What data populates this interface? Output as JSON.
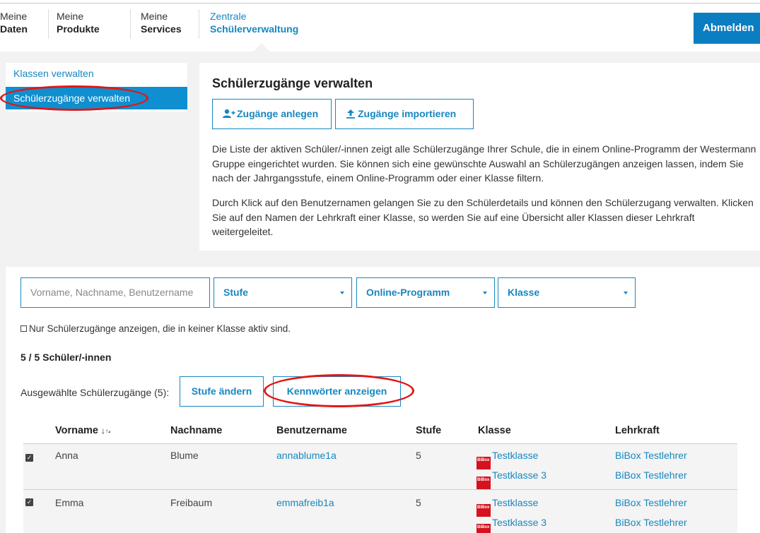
{
  "nav": {
    "items": [
      {
        "line1": "Meine",
        "line2": "Daten"
      },
      {
        "line1": "Meine",
        "line2": "Produkte"
      },
      {
        "line1": "Meine",
        "line2": "Services"
      },
      {
        "line1": "Zentrale",
        "line2": "Schülerverwaltung"
      }
    ],
    "logout_label": "Abmelden"
  },
  "sidebar": {
    "items": [
      {
        "label": "Klassen verwalten"
      },
      {
        "label": "Schülerzugänge verwalten"
      }
    ]
  },
  "panel": {
    "title": "Schülerzugänge verwalten",
    "create_label": "Zugänge anlegen",
    "import_label": "Zugänge importieren",
    "para1": "Die Liste der aktiven Schüler/-innen zeigt alle Schülerzugänge Ihrer Schule, die in einem Online-Programm der Westermann Gruppe eingerichtet wurden. Sie können sich eine gewünschte Auswahl an Schülerzugängen anzeigen lassen, indem Sie nach der Jahrgangsstufe, einem Online-Programm oder einer Klasse filtern.",
    "para2": "Durch Klick auf den Benutzernamen gelangen Sie zu den Schülerdetails und können den Schülerzugang verwalten. Klicken Sie auf den Namen der Lehrkraft einer Klasse, so werden Sie auf eine Übersicht aller Klassen dieser Lehrkraft weitergeleitet."
  },
  "filters": {
    "search_placeholder": "Vorname, Nachname, Benutzername",
    "stufe": "Stufe",
    "programm": "Online-Programm",
    "klasse": "Klasse",
    "only_inactive": "Nur Schülerzugänge anzeigen, die in keiner Klasse aktiv sind."
  },
  "summary": {
    "count": "5 / 5 Schüler/-innen",
    "selected_label": "Ausgewählte Schülerzugänge (5):",
    "change_level": "Stufe ändern",
    "show_passwords": "Kennwörter anzeigen"
  },
  "table": {
    "headers": [
      "Vorname ↓₂",
      "Nachname",
      "Benutzername",
      "Stufe",
      "Klasse",
      "Lehrkraft"
    ],
    "header_vorname": "Vorname",
    "sort_icon_text": "↓",
    "rows": [
      {
        "vorname": "Anna",
        "nachname": "Blume",
        "benutzername": "annablume1a",
        "stufe": "5",
        "klassen": [
          "Testklasse",
          "Testklasse 3"
        ],
        "lehrkraft": [
          "BiBox Testlehrer",
          "BiBox Testlehrer"
        ]
      },
      {
        "vorname": "Emma",
        "nachname": "Freibaum",
        "benutzername": "emmafreib1a",
        "stufe": "5",
        "klassen": [
          "Testklasse",
          "Testklasse 3"
        ],
        "lehrkraft": [
          "BiBox Testlehrer",
          "BiBox Testlehrer"
        ]
      }
    ],
    "badge_text": "BiBox"
  },
  "colors": {
    "accent": "#1787c0",
    "logout_bg": "#0b7dc1",
    "sidebar_active": "#0f8fd0",
    "bibox_red": "#d5121e",
    "annotation_red": "#e01717"
  }
}
